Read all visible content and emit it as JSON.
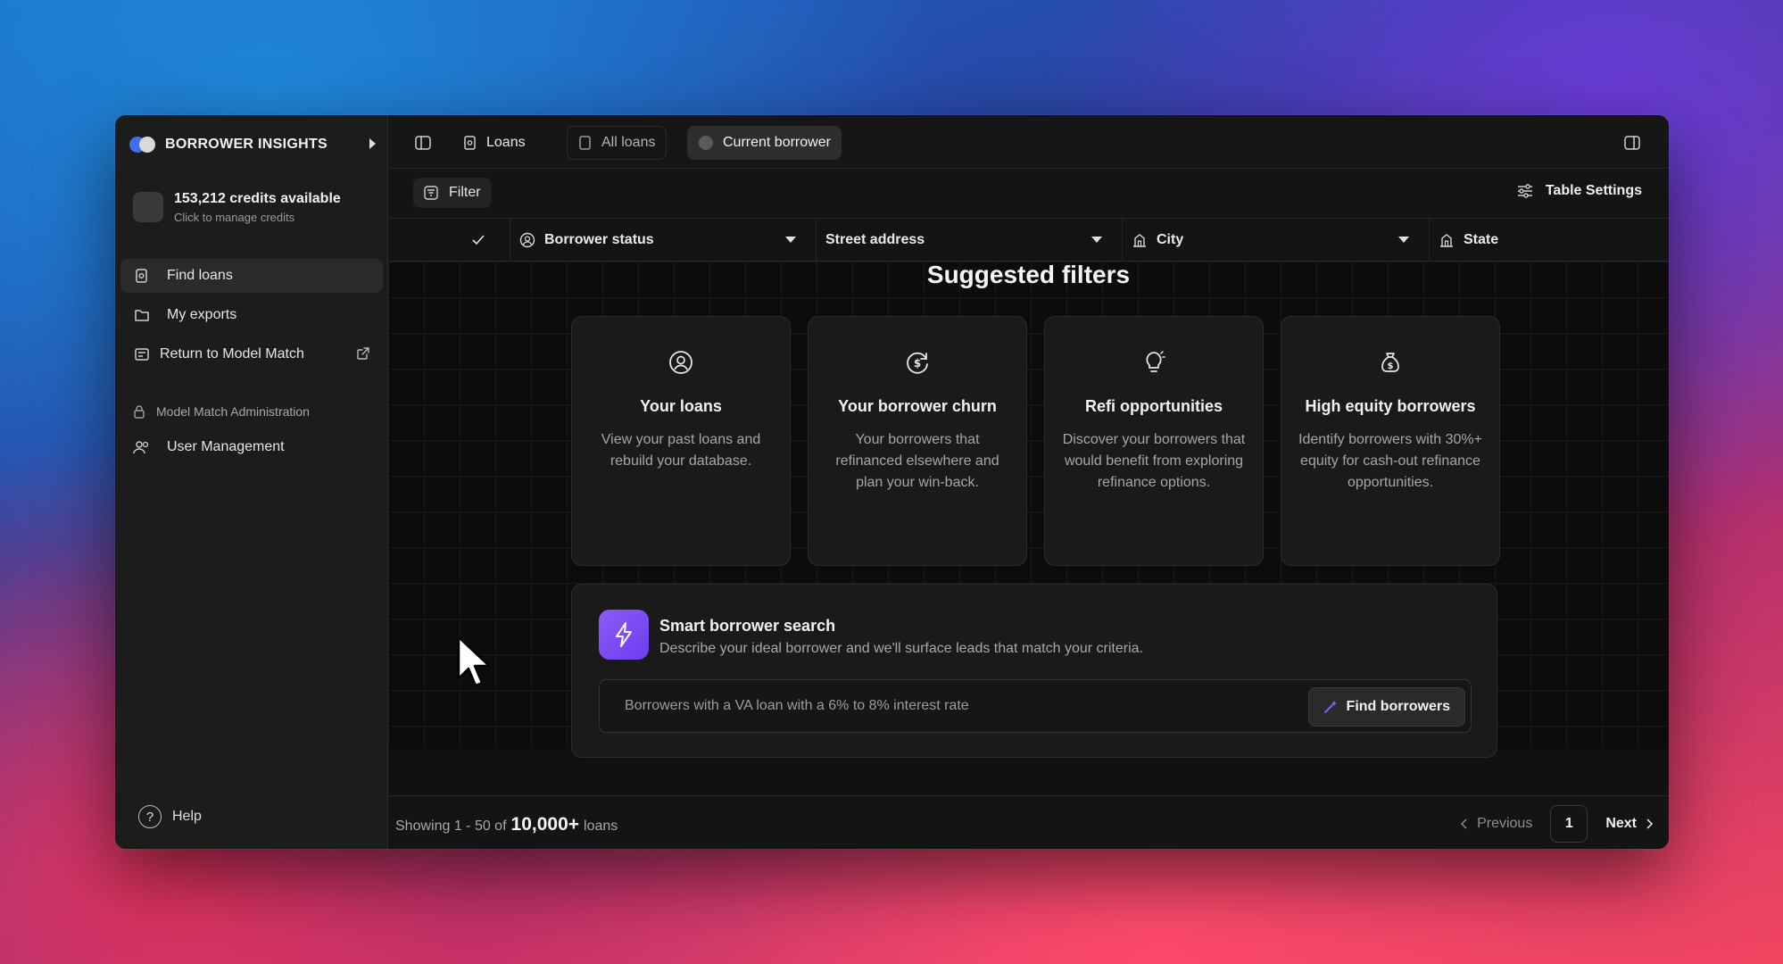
{
  "sidebar": {
    "brand": "BORROWER INSIGHTS",
    "credits": {
      "main": "153,212 credits available",
      "sub": "Click to manage credits"
    },
    "nav": [
      {
        "label": "Find loans",
        "icon": "loans-icon",
        "active": true
      },
      {
        "label": "My exports",
        "icon": "folder-icon",
        "active": false
      },
      {
        "label": "Return to Model Match",
        "icon": "model-match-icon",
        "active": false,
        "external": true
      }
    ],
    "admin_section": "Model Match Administration",
    "admin_nav": [
      {
        "label": "User Management",
        "icon": "users-icon"
      }
    ],
    "help": "Help"
  },
  "topbar": {
    "tabs": [
      {
        "label": "Loans",
        "icon": "loans-icon"
      },
      {
        "label": "All loans",
        "icon": "document-icon"
      },
      {
        "label": "Current borrower",
        "icon": "circle-icon",
        "active": true
      }
    ]
  },
  "filterbar": {
    "filter_label": "Filter",
    "table_settings_label": "Table Settings"
  },
  "columns": [
    {
      "label": "Borrower status",
      "icon": "user-circle-icon"
    },
    {
      "label": "Street address",
      "icon": ""
    },
    {
      "label": "City",
      "icon": "building-icon"
    },
    {
      "label": "State",
      "icon": "building-icon"
    }
  ],
  "suggested": {
    "title": "Suggested filters",
    "cards": [
      {
        "title": "Your loans",
        "desc": "View your past loans and rebuild your database.",
        "icon": "user-circle-icon"
      },
      {
        "title": "Your borrower churn",
        "desc": "Your borrowers that refinanced elsewhere and plan your win-back.",
        "icon": "dollar-refresh-icon"
      },
      {
        "title": "Refi opportunities",
        "desc": "Discover your borrowers that would benefit from exploring refinance options.",
        "icon": "lightbulb-icon"
      },
      {
        "title": "High equity borrowers",
        "desc": "Identify borrowers with 30%+ equity for cash-out refinance opportunities.",
        "icon": "money-bag-icon"
      }
    ]
  },
  "smart_search": {
    "title": "Smart borrower search",
    "subtitle": "Describe your ideal borrower and we'll surface leads that match your criteria.",
    "placeholder": "Borrowers with a VA loan with a 6% to 8% interest rate",
    "button": "Find borrowers",
    "accent": "#7c4dff"
  },
  "footer": {
    "showing_prefix": "Showing 1 - 50 of",
    "total": "10,000+",
    "suffix": "loans",
    "previous": "Previous",
    "page": "1",
    "next": "Next"
  }
}
